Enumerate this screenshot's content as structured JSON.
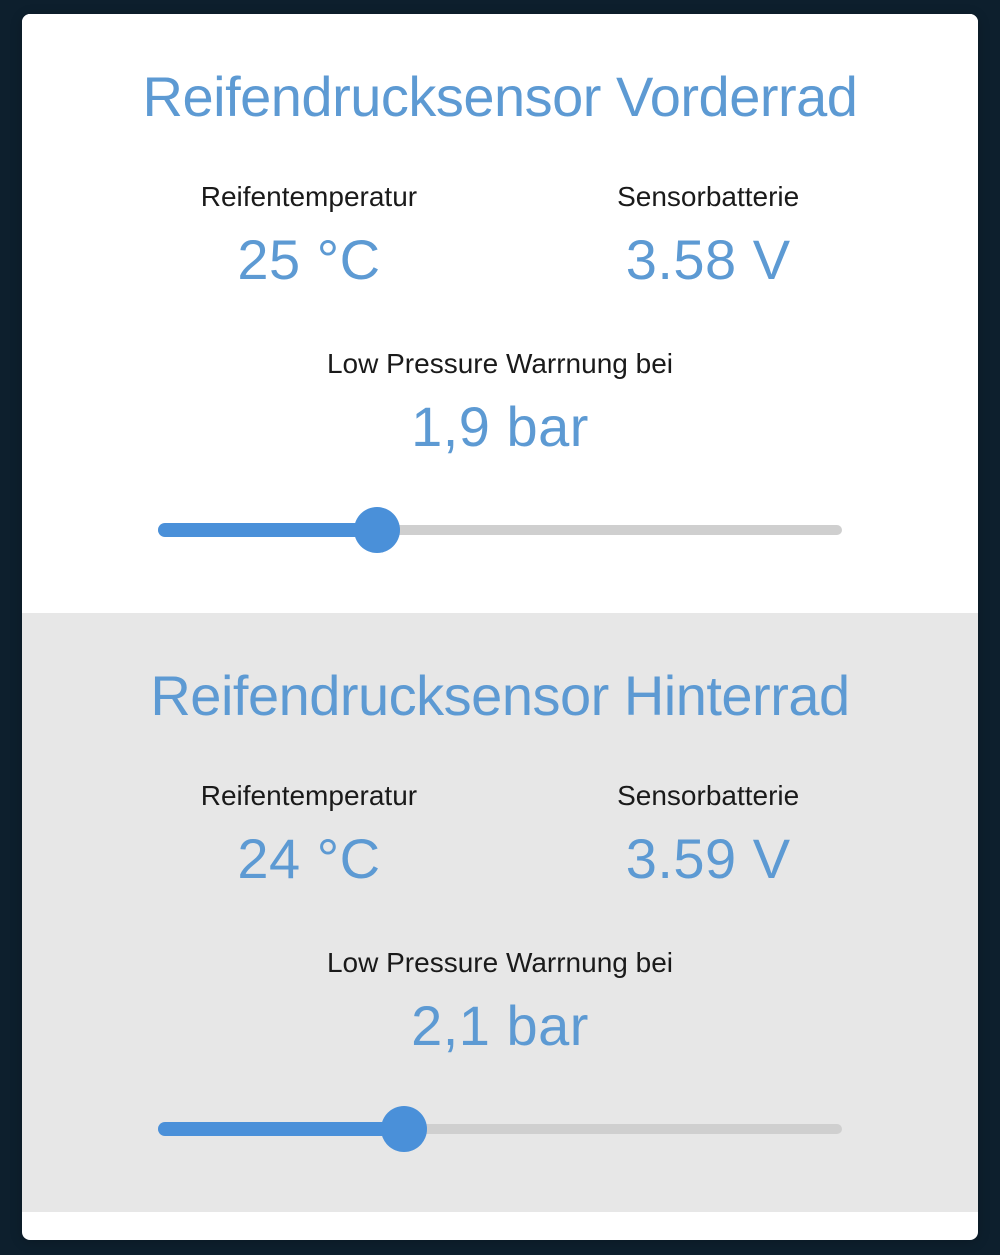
{
  "colors": {
    "accent": "#5d9ad3",
    "slider": "#4a90d9"
  },
  "front": {
    "title": "Reifendrucksensor Vorderrad",
    "temp_label": "Reifentemperatur",
    "temp_value": "25 °C",
    "batt_label": "Sensorbatterie",
    "batt_value": "3.58 V",
    "warn_label": "Low Pressure Warrnung bei",
    "warn_value": "1,9 bar",
    "slider_percent": 32
  },
  "rear": {
    "title": "Reifendrucksensor Hinterrad",
    "temp_label": "Reifentemperatur",
    "temp_value": "24 °C",
    "batt_label": "Sensorbatterie",
    "batt_value": "3.59 V",
    "warn_label": "Low Pressure Warrnung bei",
    "warn_value": "2,1 bar",
    "slider_percent": 36
  }
}
